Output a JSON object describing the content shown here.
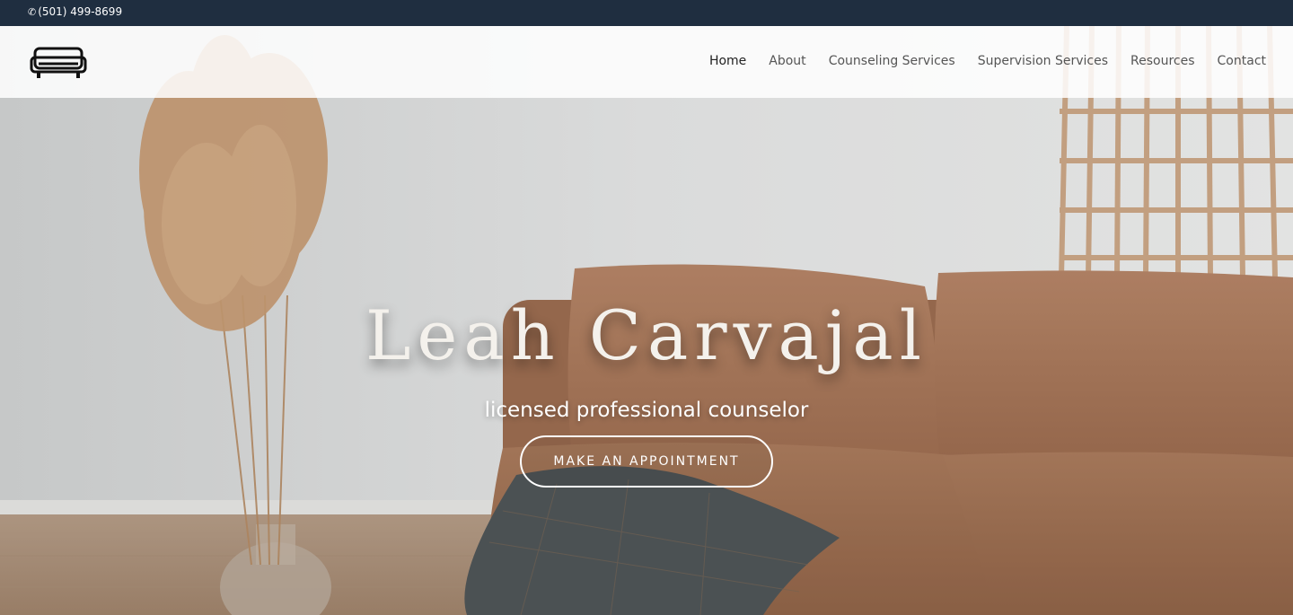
{
  "topbar": {
    "phone": "(501) 499-8699"
  },
  "header": {
    "logo_icon": "sofa-icon",
    "nav": [
      {
        "label": "Home",
        "active": true
      },
      {
        "label": "About",
        "active": false
      },
      {
        "label": "Counseling Services",
        "active": false
      },
      {
        "label": "Supervision Services",
        "active": false
      },
      {
        "label": "Resources",
        "active": false
      },
      {
        "label": "Contact",
        "active": false
      }
    ]
  },
  "hero": {
    "title": "Leah Carvajal",
    "subtitle": "licensed professional counselor",
    "cta_label": "MAKE AN APPOINTMENT"
  },
  "colors": {
    "topbar_bg": "#1f2e40",
    "sofa": "#a87a5f",
    "pampas": "#c59a72",
    "blanket": "#4f5557"
  }
}
